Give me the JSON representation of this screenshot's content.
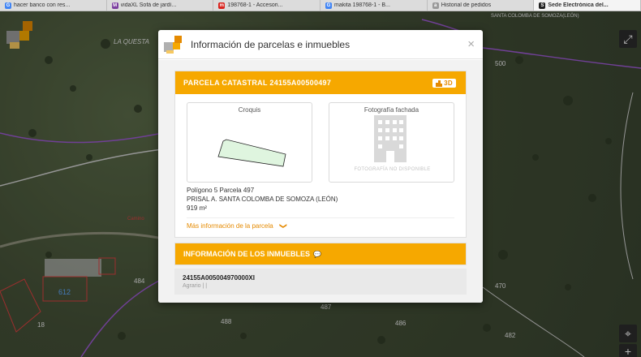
{
  "browser": {
    "tabs": [
      {
        "label": "hacer banco con res...",
        "fav": "G",
        "fav_color": "#4285f4"
      },
      {
        "label": "vidaXL Sofá de jardí...",
        "fav": "M",
        "fav_color": "#7c3fa0"
      },
      {
        "label": "198768-1 - Accesori...",
        "fav": "m",
        "fav_color": "#d9231d"
      },
      {
        "label": "makita 198768-1 - B...",
        "fav": "G",
        "fav_color": "#4285f4"
      },
      {
        "label": "Historial de pedidos",
        "fav": "a",
        "fav_color": "#9a9a9a"
      },
      {
        "label": "Sede Electrónica del...",
        "fav": "S",
        "fav_color": "#222222",
        "active": true
      }
    ]
  },
  "map": {
    "labels": [
      "LA QUESTA",
      "SANTA COLOMBA DE SOMOZA(LEÓN)",
      "500",
      "484",
      "488",
      "487",
      "486",
      "482",
      "470",
      "18",
      "612",
      "Camino"
    ],
    "colors": {
      "accent": "#f6a800",
      "parcel_line": "#9b59d0"
    }
  },
  "modal": {
    "title": "Información de parcelas e inmuebles",
    "close_label": "×",
    "parcela": {
      "header": "PARCELA CATASTRAL 24155A00500497",
      "badge": "3D",
      "croquis_label": "Croquis",
      "foto_label": "Fotografía fachada",
      "foto_placeholder": "FOTOGRAFÍA NO DISPONIBLE",
      "poligono": "Polígono 5 Parcela 497",
      "paraje": "PRISAL A. SANTA COLOMBA DE SOMOZA (LEÓN)",
      "superficie": "919 m²",
      "more_link": "Más información de la parcela"
    },
    "inmuebles": {
      "header": "INFORMACIÓN DE LOS INMUEBLES",
      "items": [
        {
          "ref": "24155A005004970000XI",
          "uso": "Agrario | |"
        }
      ]
    }
  }
}
